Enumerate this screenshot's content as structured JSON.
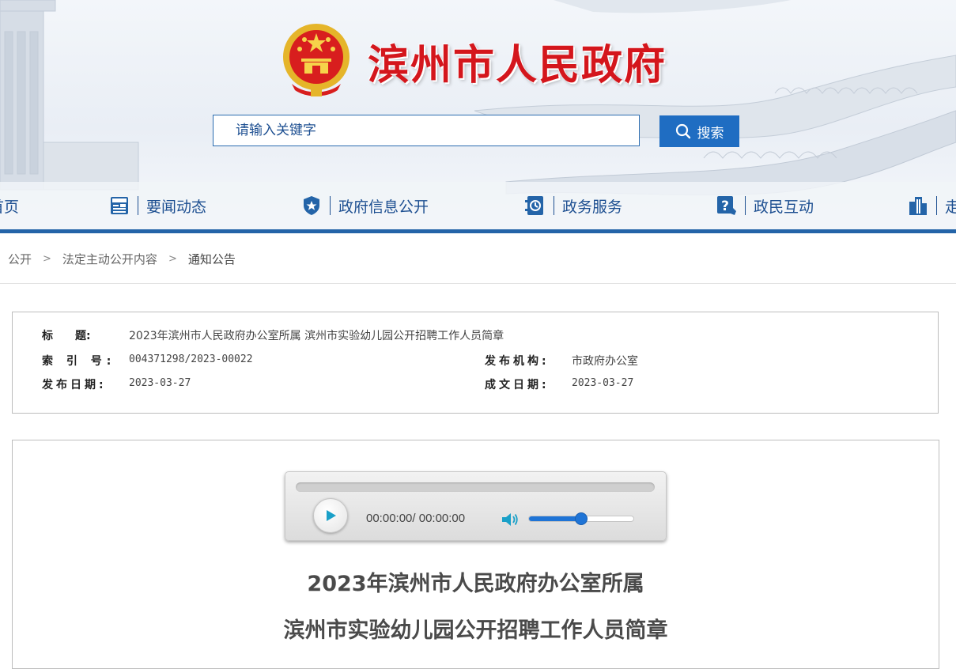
{
  "site": {
    "title": "滨州市人民政府",
    "emblem_icon": "national-emblem-icon",
    "accent": "#d4161c",
    "brand_blue": "#1f6dc2"
  },
  "search": {
    "placeholder": "请输入关键字",
    "button_label": "搜索",
    "icon": "search-icon"
  },
  "nav": {
    "items": [
      {
        "label": "首页",
        "icon": ""
      },
      {
        "label": "要闻动态",
        "icon": "news-icon"
      },
      {
        "label": "政府信息公开",
        "icon": "shield-star-icon"
      },
      {
        "label": "政务服务",
        "icon": "service-icon"
      },
      {
        "label": "政民互动",
        "icon": "question-icon"
      },
      {
        "label": "走",
        "icon": "building-icon"
      }
    ]
  },
  "breadcrumb": {
    "items": [
      "公开",
      "法定主动公开内容",
      "通知公告"
    ],
    "separator": ">"
  },
  "info": {
    "title_label": "标　　题:",
    "title_value": "2023年滨州市人民政府办公室所属 滨州市实验幼儿园公开招聘工作人员简章",
    "index_label": "索 引 号:",
    "index_value": "004371298/2023-00022",
    "issuer_label": "发布机构:",
    "issuer_value": "市政府办公室",
    "pub_date_label": "发布日期:",
    "pub_date_value": "2023-03-27",
    "doc_date_label": "成文日期:",
    "doc_date_value": "2023-03-27"
  },
  "player": {
    "time_text": "00:00:00/ 00:00:00",
    "progress": 0,
    "volume": 0.5,
    "play_icon": "play-icon",
    "volume_icon": "volume-icon"
  },
  "article": {
    "title_line1": "2023年滨州市人民政府办公室所属",
    "title_line2": "滨州市实验幼儿园公开招聘工作人员简章"
  }
}
